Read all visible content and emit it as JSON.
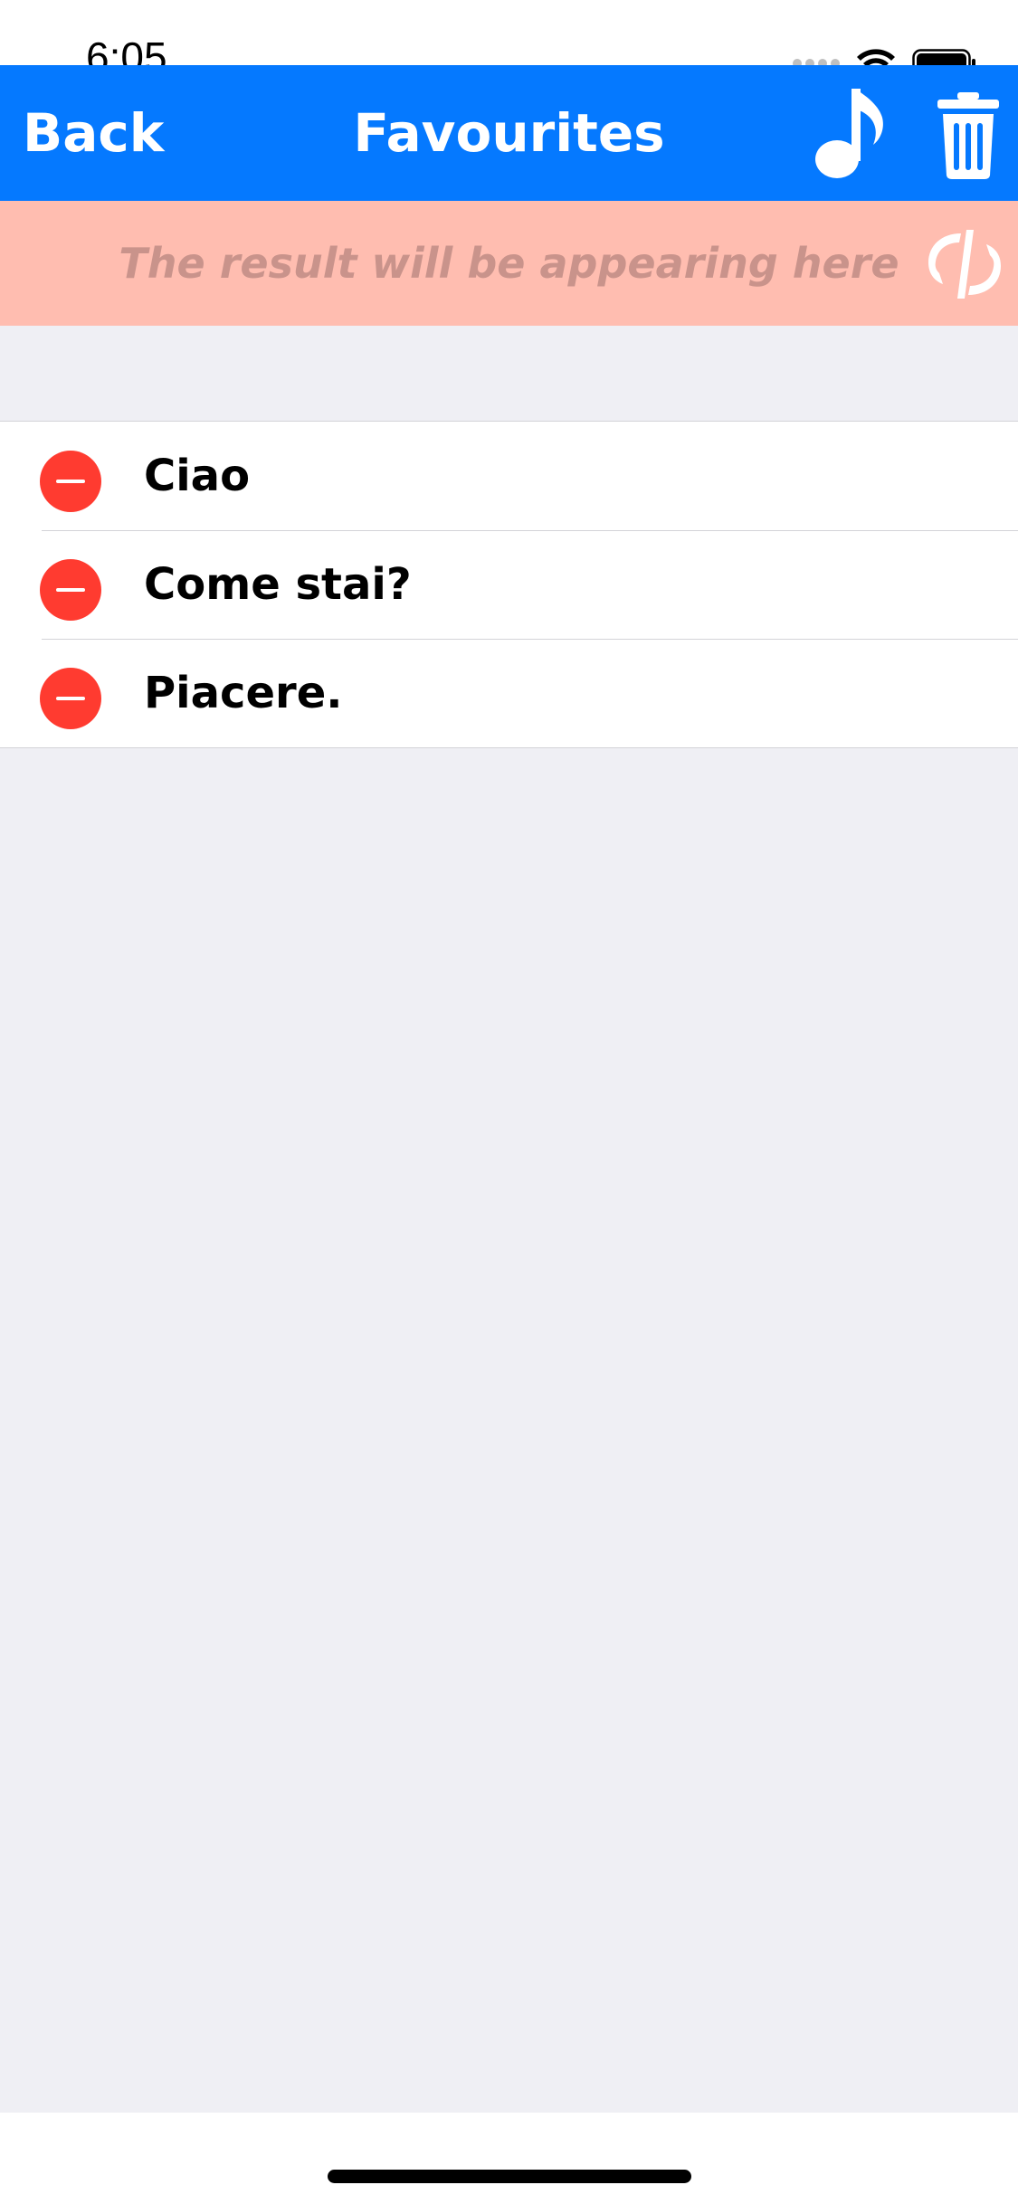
{
  "status_bar": {
    "time": "6:05",
    "icons": [
      "cellular-icon",
      "wifi-icon",
      "battery-icon"
    ]
  },
  "nav": {
    "back_label": "Back",
    "title": "Favourites",
    "music_icon": "music-note-icon",
    "trash_icon": "trash-icon",
    "background_color": "#0579FF"
  },
  "result": {
    "text": "The result will be appearing here",
    "swap_icon": "swap-icon",
    "background_color": "#FFBDB0"
  },
  "favourites": {
    "items": [
      {
        "label": "Ciao"
      },
      {
        "label": "Come stai?"
      },
      {
        "label": "Piacere."
      }
    ],
    "delete_color": "#FF3B30"
  }
}
